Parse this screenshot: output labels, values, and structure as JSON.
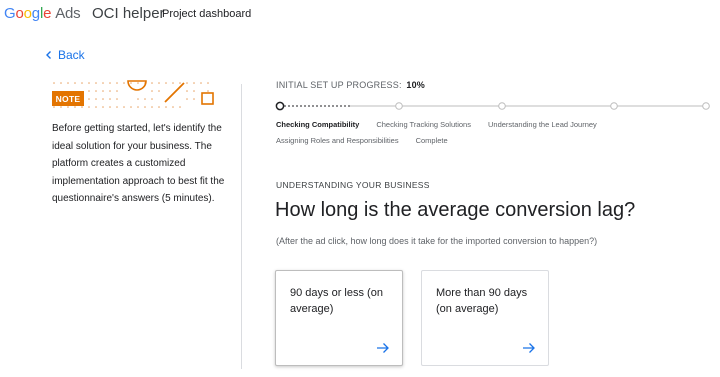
{
  "header": {
    "logo_g": "Google",
    "logo_ads": "Ads",
    "app_title": "OCI helper",
    "tab": "Project dashboard"
  },
  "back_label": "Back",
  "note": {
    "badge": "NOTE",
    "text": "Before getting started, let's identify the ideal solution for your business. The platform creates a customized implementation approach to best fit the questionnaire's answers (5 minutes)."
  },
  "progress": {
    "label": "INITIAL SET UP PROGRESS:",
    "value": "10%",
    "fraction": 0.1,
    "steps": [
      {
        "label": "Checking Compatibility",
        "active": true
      },
      {
        "label": "Checking Tracking Solutions",
        "active": false
      },
      {
        "label": "Understanding the Lead Journey",
        "active": false
      },
      {
        "label": "Assigning Roles and Responsibilities",
        "active": false
      },
      {
        "label": "Complete",
        "active": false
      }
    ]
  },
  "section_label": "UNDERSTANDING YOUR BUSINESS",
  "question": "How long is the average conversion lag?",
  "helper_text": "(After the ad click, how long does it take for the imported conversion to happen?)",
  "options": [
    {
      "label": "90 days or less (on average)",
      "selected": true
    },
    {
      "label": "More than 90 days (on average)",
      "selected": false
    }
  ],
  "colors": {
    "accent": "#1a73e8",
    "note_orange": "#e37400"
  },
  "icons": {
    "back": "chevron-left-icon",
    "option_arrow": "arrow-right-icon"
  }
}
